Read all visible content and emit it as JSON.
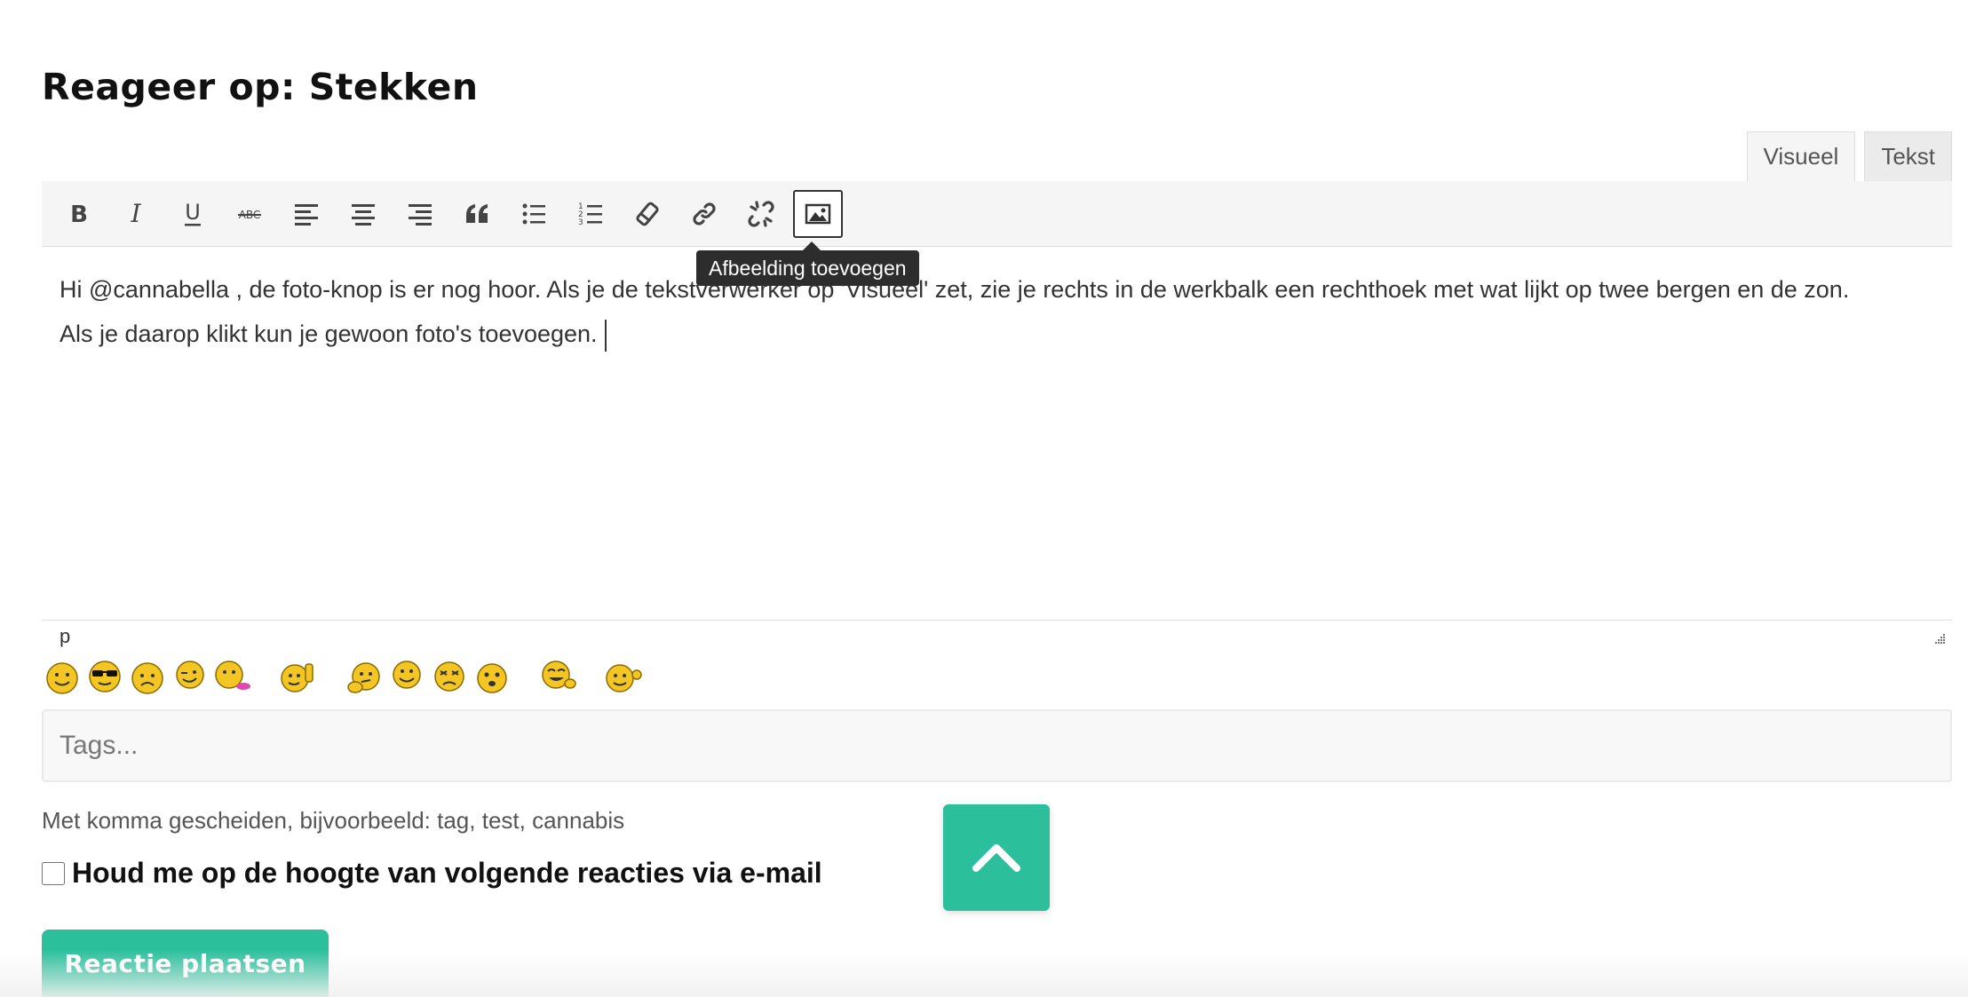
{
  "page": {
    "title": "Reageer op: Stekken"
  },
  "editor": {
    "tabs": [
      {
        "label": "Visueel",
        "active": true
      },
      {
        "label": "Tekst",
        "active": false
      }
    ],
    "toolbar": [
      {
        "icon": "bold-icon",
        "label": "B"
      },
      {
        "icon": "italic-icon",
        "label": "I"
      },
      {
        "icon": "underline-icon",
        "label": "U"
      },
      {
        "icon": "strikethrough-icon",
        "label": "ABC"
      },
      {
        "icon": "align-left-icon"
      },
      {
        "icon": "align-center-icon"
      },
      {
        "icon": "align-right-icon"
      },
      {
        "icon": "blockquote-icon"
      },
      {
        "icon": "bullet-list-icon"
      },
      {
        "icon": "numbered-list-icon"
      },
      {
        "icon": "eraser-icon"
      },
      {
        "icon": "link-icon"
      },
      {
        "icon": "unlink-icon"
      },
      {
        "icon": "image-icon",
        "active": true
      }
    ],
    "tooltip": "Afbeelding toevoegen",
    "content_line1": "Hi @cannabella , de foto-knop is er nog hoor. Als je de tekstverwerker op 'Visueel' zet, zie je rechts in de werkbalk een rechthoek met wat lijkt op twee bergen en de zon.",
    "content_line2": "Als je daarop klikt kun je gewoon foto's toevoegen.",
    "status_path": "p"
  },
  "smilies": [
    "smile-icon",
    "cool-icon",
    "sad-icon",
    "wink-icon",
    "kiss-icon",
    "thumbs-up-icon",
    "thinking-icon",
    "happy-icon",
    "confused-icon",
    "surprised-icon",
    "laughing-icon",
    "wave-icon"
  ],
  "tags": {
    "placeholder": "Tags...",
    "hint": "Met komma gescheiden, bijvoorbeeld: tag, test, cannabis"
  },
  "subscribe": {
    "label": "Houd me op de hoogte van volgende reacties via e-mail",
    "checked": false
  },
  "submit": {
    "label": "Reactie plaatsen"
  },
  "colors": {
    "accent": "#2bbf9c",
    "toolbar_bg": "#f5f5f5",
    "tooltip_bg": "#2d2d2d"
  }
}
